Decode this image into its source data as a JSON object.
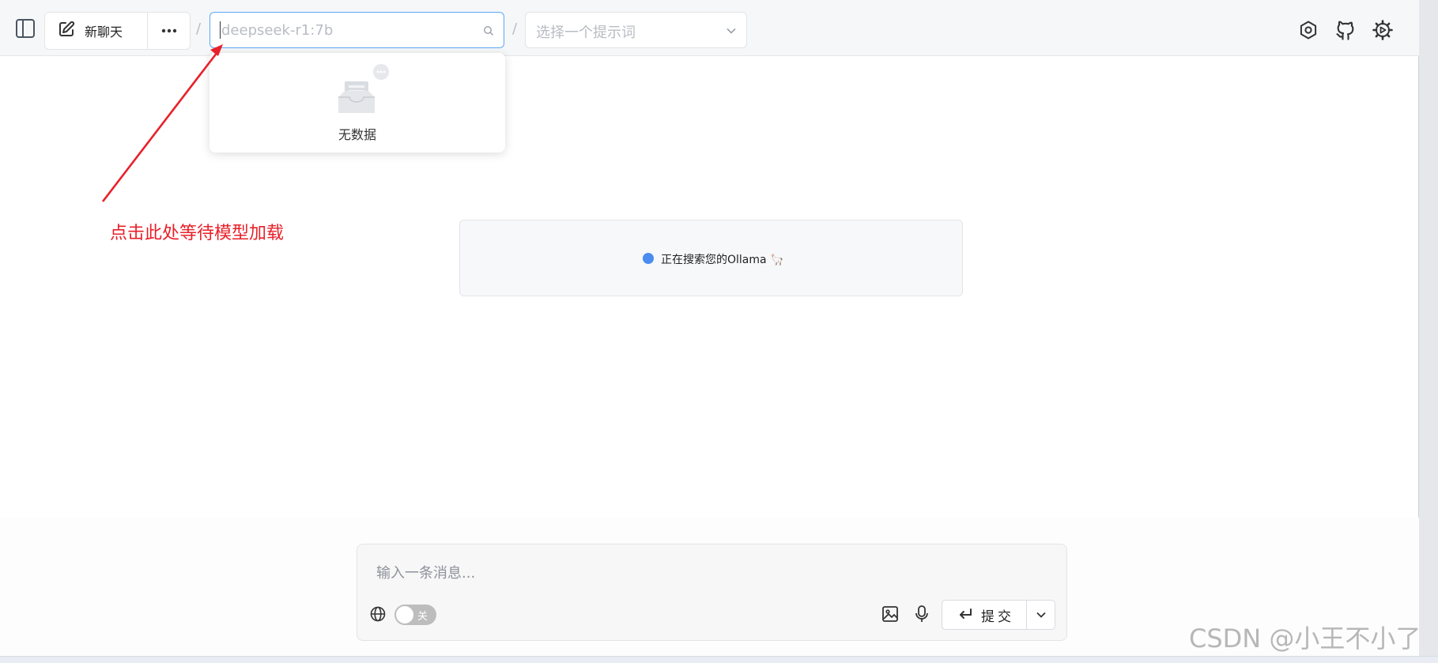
{
  "header": {
    "new_chat_label": "新聊天",
    "separator": "/",
    "model_input": {
      "value": "",
      "placeholder": "deepseek-r1:7b"
    },
    "prompt_select_placeholder": "选择一个提示词"
  },
  "model_dropdown": {
    "empty_text": "无数据"
  },
  "annotation": {
    "text": "点击此处等待模型加载",
    "color": "#e8202a"
  },
  "status": {
    "text": "正在搜索您的Ollama 🦙"
  },
  "composer": {
    "placeholder": "输入一条消息...",
    "web_search_toggle_label": "关",
    "submit_label": "提交"
  },
  "watermark": "CSDN @小王不小了",
  "colors": {
    "accent": "#5aa8f5",
    "status_dot": "#4a8cf0",
    "annotation": "#e8202a"
  }
}
